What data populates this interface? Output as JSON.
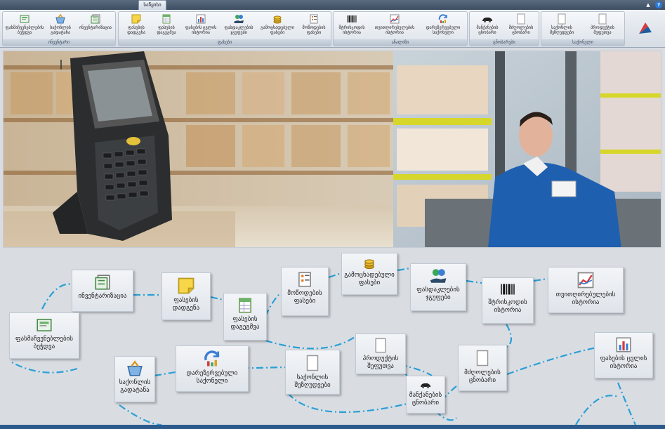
{
  "titlebar": {
    "tab_label": "საწყისი",
    "help_label": "?",
    "minimize_label": "▲"
  },
  "ribbon": {
    "groups": [
      {
        "title": "ინვენტარი",
        "buttons": [
          "ფასმაჩვენებლების\nბეჭდვა",
          "საქონლის\nგადატანა",
          "ინვენტარიზაცია"
        ]
      },
      {
        "title": "ფასები",
        "buttons": [
          "ფასების\nდადგენა",
          "ფასების\nდაგეგმვა",
          "ფასების ცვლის\nისტორია",
          "ფასდაკლების\nჯგუფები",
          "გამოცხადებული\nფასები",
          "მოწოდების\nფასები"
        ]
      },
      {
        "title": "ანალიზი",
        "buttons": [
          "შტრიხკოდის\nისტორია",
          "თვითღირებულების\nისტორია",
          "დარეზერვებული\nსაქონელი"
        ]
      },
      {
        "title": "ცნობარები",
        "buttons": [
          "მანქანების\nცნობარი",
          "მძღოლების\nცნობარი"
        ]
      },
      {
        "title": "საქონელი",
        "buttons": [
          "საქონლის\nშეზღუდვები",
          "პროდუქტის\nშეფუთვა"
        ]
      }
    ]
  },
  "diagram": {
    "nodes": [
      {
        "key": "inventory",
        "label": "ინვენტარიზაცია",
        "icon": "inventory-icon"
      },
      {
        "key": "price_set",
        "label": "ფასების\nდადგენა",
        "icon": "sticky-note-icon"
      },
      {
        "key": "price_plan",
        "label": "ფასების\nდაგეგმვა",
        "icon": "spreadsheet-icon"
      },
      {
        "key": "supply_prices",
        "label": "მოწოდების\nფასები",
        "icon": "document-list-icon"
      },
      {
        "key": "announced_prices",
        "label": "გამოცხადებული\nფასები",
        "icon": "coins-icon"
      },
      {
        "key": "discount_groups",
        "label": "ფასდაკლების\nჯგუფები",
        "icon": "discount-hand-icon"
      },
      {
        "key": "barcode_history",
        "label": "შტრიხკოდის\nისტორია",
        "icon": "barcode-icon"
      },
      {
        "key": "cost_history",
        "label": "თვითღირებულების\nისტორია",
        "icon": "line-chart-icon"
      },
      {
        "key": "price_tags",
        "label": "ფასმაჩვენებლების\nბეჭდვა",
        "icon": "price-tag-print-icon"
      },
      {
        "key": "goods_transfer",
        "label": "საქონლის\nგადატანა",
        "icon": "basket-icon"
      },
      {
        "key": "reserved_goods",
        "label": "დარეზერვებული\nსაქონელი",
        "icon": "reserve-refresh-icon"
      },
      {
        "key": "goods_limits",
        "label": "საქონლის\nშეზღუდვები",
        "icon": "blank-page-icon"
      },
      {
        "key": "product_pack",
        "label": "პროდუქტის\nშეფუთვა",
        "icon": "blank-page-icon"
      },
      {
        "key": "cars_dir",
        "label": "მანქანების\nცნობარი",
        "icon": "car-icon"
      },
      {
        "key": "drivers_dir",
        "label": "მძღოლების\nცნობარი",
        "icon": "blank-page-icon"
      },
      {
        "key": "price_change_history",
        "label": "ფასების ცვლის\nისტორია",
        "icon": "bar-chart-icon"
      }
    ]
  },
  "colors": {
    "accent": "#2a9fd6",
    "connector": "#2a9fd6",
    "bottom_bar": "#2d5a8c"
  }
}
